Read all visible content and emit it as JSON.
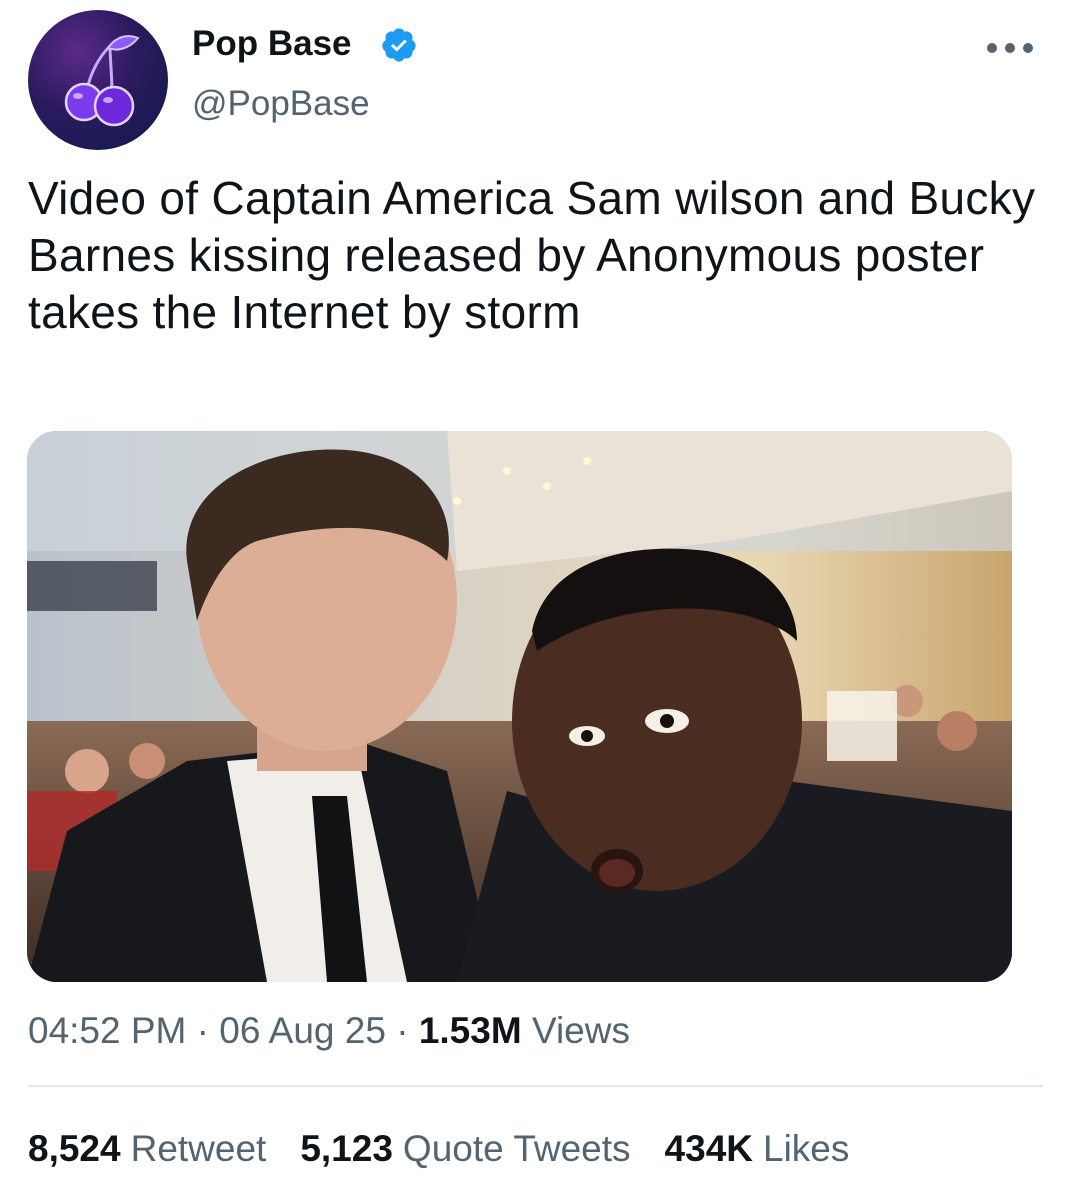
{
  "author": {
    "display_name": "Pop Base",
    "handle": "@PopBase"
  },
  "tweet": {
    "text": "Video of Captain America Sam wilson and Bucky Barnes kissing released by Anonymous poster takes the Internet by storm"
  },
  "meta": {
    "time": "04:52 PM",
    "separator": "·",
    "date": "06 Aug 25",
    "views_count": "1.53M",
    "views_label": "Views"
  },
  "stats": {
    "retweets_count": "8,524",
    "retweets_label": "Retweet",
    "quotes_count": "5,123",
    "quotes_label": "Quote Tweets",
    "likes_count": "434K",
    "likes_label": "Likes"
  },
  "icons": {
    "avatar": "cherry-icon",
    "verified": "verified-badge-icon",
    "more": "more-options-icon"
  },
  "colors": {
    "verified_blue": "#1d9bf0",
    "secondary_text": "#536471",
    "primary_text": "#0f1419"
  }
}
